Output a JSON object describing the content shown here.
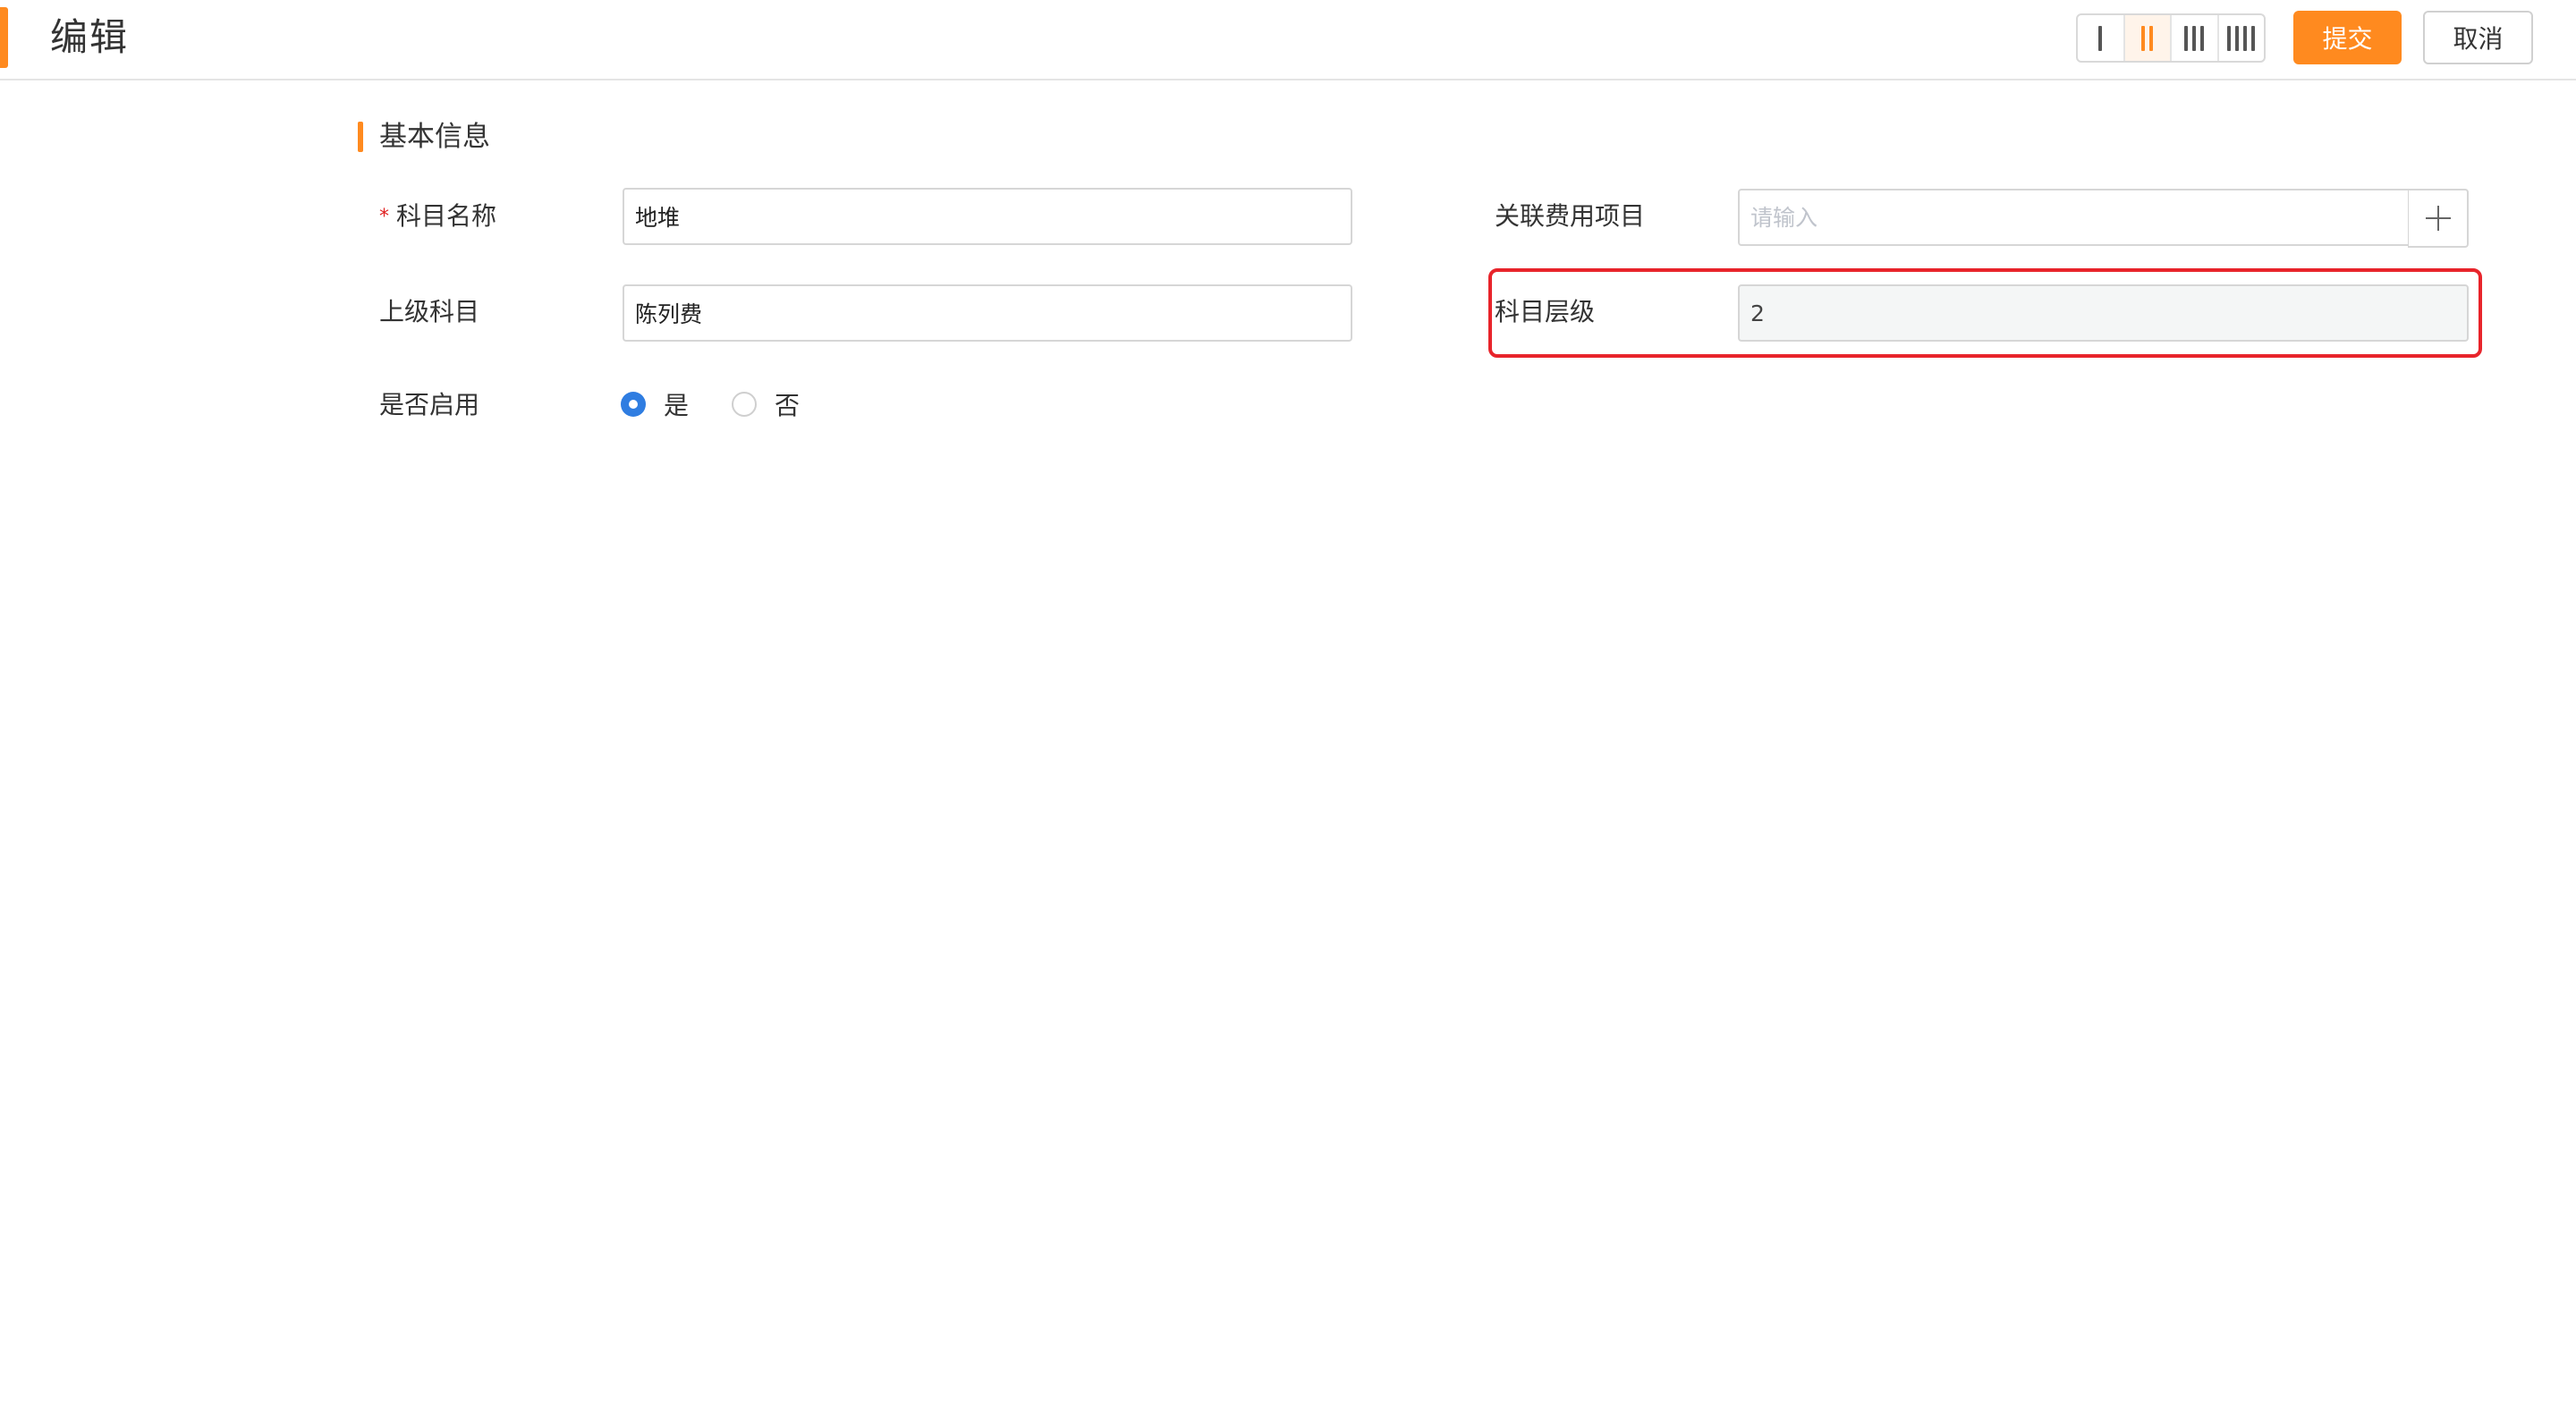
{
  "header": {
    "title": "编辑",
    "submit_label": "提交",
    "cancel_label": "取消",
    "column_options": [
      "1-column",
      "2-column",
      "3-column",
      "4-column"
    ],
    "selected_columns": 2
  },
  "section": {
    "title": "基本信息"
  },
  "form": {
    "subject_name": {
      "label": "科目名称",
      "required_mark": "*",
      "value": "地堆"
    },
    "parent_subject": {
      "label": "上级科目",
      "value": "陈列费"
    },
    "enabled": {
      "label": "是否启用",
      "options": [
        "是",
        "否"
      ],
      "selected": "是"
    },
    "related_expense": {
      "label": "关联费用项目",
      "placeholder": "请输入",
      "value": ""
    },
    "subject_level": {
      "label": "科目层级",
      "value": "2"
    }
  },
  "colors": {
    "accent": "#ff8a1f",
    "highlight": "#e8242b",
    "radio_checked": "#2f7de1"
  }
}
